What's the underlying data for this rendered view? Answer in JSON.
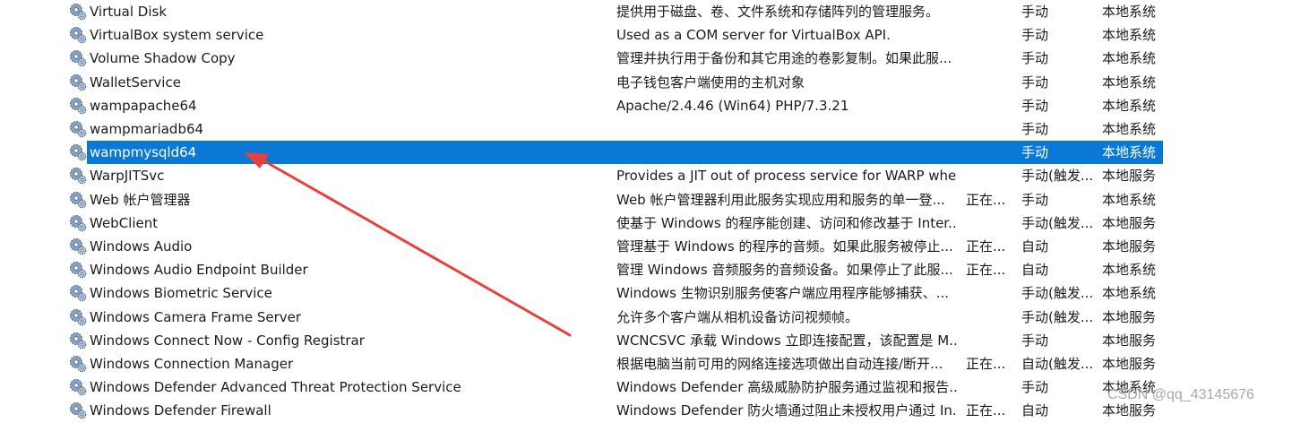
{
  "services": [
    {
      "name": "Virtual Disk",
      "description": "提供用于磁盘、卷、文件系统和存储阵列的管理服务。",
      "status": "",
      "startup": "手动",
      "logon": "本地系统"
    },
    {
      "name": "VirtualBox system service",
      "description": "Used as a COM server for VirtualBox API.",
      "status": "",
      "startup": "手动",
      "logon": "本地系统"
    },
    {
      "name": "Volume Shadow Copy",
      "description": "管理并执行用于备份和其它用途的卷影复制。如果此服...",
      "status": "",
      "startup": "手动",
      "logon": "本地系统"
    },
    {
      "name": "WalletService",
      "description": "电子钱包客户端使用的主机对象",
      "status": "",
      "startup": "手动",
      "logon": "本地系统"
    },
    {
      "name": "wampapache64",
      "description": "Apache/2.4.46 (Win64) PHP/7.3.21",
      "status": "",
      "startup": "手动",
      "logon": "本地系统"
    },
    {
      "name": "wampmariadb64",
      "description": "",
      "status": "",
      "startup": "手动",
      "logon": "本地系统"
    },
    {
      "name": "wampmysqld64",
      "description": "",
      "status": "",
      "startup": "手动",
      "logon": "本地系统"
    },
    {
      "name": "WarpJITSvc",
      "description": "Provides a JIT out of process service for WARP when r...",
      "status": "",
      "startup": "手动(触发...",
      "logon": "本地服务"
    },
    {
      "name": "Web 帐户管理器",
      "description": "Web 帐户管理器利用此服务实现应用和服务的单一登...",
      "status": "正在...",
      "startup": "手动",
      "logon": "本地系统"
    },
    {
      "name": "WebClient",
      "description": "使基于 Windows 的程序能创建、访问和修改基于 Inter...",
      "status": "",
      "startup": "手动(触发...",
      "logon": "本地服务"
    },
    {
      "name": "Windows Audio",
      "description": "管理基于 Windows 的程序的音频。如果此服务被停止...",
      "status": "正在...",
      "startup": "自动",
      "logon": "本地服务"
    },
    {
      "name": "Windows Audio Endpoint Builder",
      "description": "管理 Windows 音频服务的音频设备。如果停止了此服...",
      "status": "正在...",
      "startup": "自动",
      "logon": "本地系统"
    },
    {
      "name": "Windows Biometric Service",
      "description": "Windows 生物识别服务使客户端应用程序能够捕获、...",
      "status": "",
      "startup": "手动(触发...",
      "logon": "本地系统"
    },
    {
      "name": "Windows Camera Frame Server",
      "description": "允许多个客户端从相机设备访问视频帧。",
      "status": "",
      "startup": "手动(触发...",
      "logon": "本地服务"
    },
    {
      "name": "Windows Connect Now - Config Registrar",
      "description": "WCNCSVC 承载 Windows 立即连接配置，该配置是 M...",
      "status": "",
      "startup": "手动",
      "logon": "本地服务"
    },
    {
      "name": "Windows Connection Manager",
      "description": "根据电脑当前可用的网络连接选项做出自动连接/断开...",
      "status": "正在...",
      "startup": "自动(触发...",
      "logon": "本地服务"
    },
    {
      "name": "Windows Defender Advanced Threat Protection Service",
      "description": "Windows Defender 高级威胁防护服务通过监视和报告...",
      "status": "",
      "startup": "手动",
      "logon": "本地系统"
    },
    {
      "name": "Windows Defender Firewall",
      "description": "Windows Defender 防火墙通过阻止未授权用户通过 In...",
      "status": "正在...",
      "startup": "自动",
      "logon": "本地服务"
    }
  ],
  "selected_service": "wampmysqld64",
  "watermark": "CSDN @qq_43145676",
  "colors": {
    "selection": "#0a78d7",
    "arrow": "#e8403a"
  },
  "icons": {
    "service": "gear-service-icon"
  }
}
